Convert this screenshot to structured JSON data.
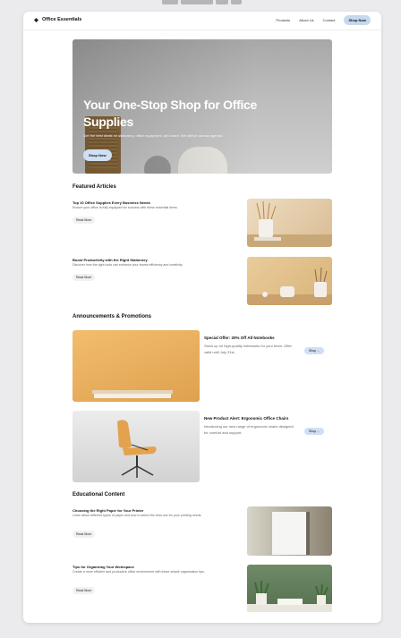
{
  "nav": {
    "brand": "Office Essentials",
    "links": [
      "Products",
      "About Us",
      "Contact"
    ],
    "cta": "Shop Now"
  },
  "hero": {
    "title": "Your One-Stop Shop for Office Supplies",
    "subtitle": "Get the best deals on stationery, office equipment, and more. We deliver across agenda.",
    "button": "Shop Now"
  },
  "featured": {
    "heading": "Featured Articles",
    "articles": [
      {
        "title": "Top 10 Office Supplies Every Business Needs",
        "desc": "Ensure your office is fully equipped for success with these essential items.",
        "button": "Read More"
      },
      {
        "title": "Boost Productivity with the Right Stationery",
        "desc": "Discover how the right tools can enhance your teams efficiency and creativity.",
        "button": "Read More"
      }
    ]
  },
  "announcements": {
    "heading": "Announcements & Promotions",
    "items": [
      {
        "title": "Special Offer: 20% Off All Notebooks",
        "desc": "Stock up on high-quality notebooks for your team. Offer valid until July 31st.",
        "button": "Shop ..."
      },
      {
        "title": "New Product Alert: Ergonomic Office Chairs",
        "desc": "Introducing our new range of ergonomic chairs designed for comfort and support.",
        "button": "Shop ..."
      }
    ]
  },
  "educational": {
    "heading": "Educational Content",
    "articles": [
      {
        "title": "Choosing the Right Paper for Your Printer",
        "desc": "Learn about different types of paper and how to select the best one for your printing needs.",
        "button": "Read More"
      },
      {
        "title": "Tips for Organizing Your Workspace",
        "desc": "Create a more efficient and productive office environment with these simple organization tips.",
        "button": "Read More"
      }
    ]
  }
}
